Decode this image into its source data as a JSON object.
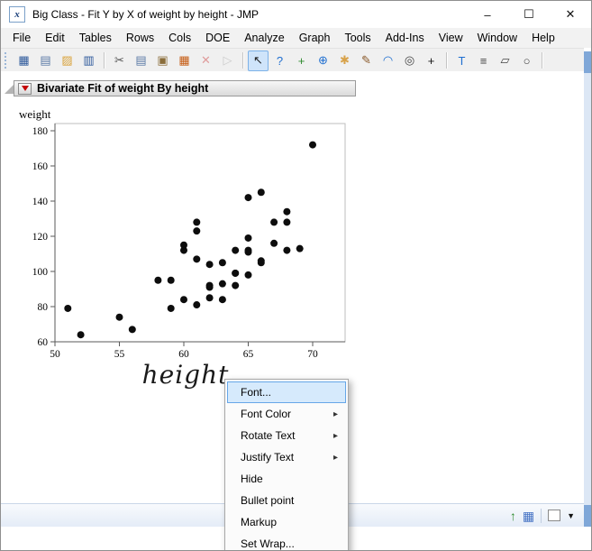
{
  "window": {
    "title": "Big Class - Fit Y by X of weight by height - JMP",
    "icon_glyph": "x",
    "controls": {
      "minimize": "–",
      "maximize": "☐",
      "close": "✕"
    }
  },
  "menu_bar": {
    "items": [
      "File",
      "Edit",
      "Tables",
      "Rows",
      "Cols",
      "DOE",
      "Analyze",
      "Graph",
      "Tools",
      "Add-Ins",
      "View",
      "Window",
      "Help"
    ]
  },
  "toolbar": {
    "buttons": [
      {
        "name": "new-data-table",
        "glyph": "▦",
        "color": "#2b579a"
      },
      {
        "name": "new-journal",
        "glyph": "▤",
        "color": "#5b7aa6"
      },
      {
        "name": "open",
        "glyph": "▨",
        "color": "#d9a33c"
      },
      {
        "name": "save",
        "glyph": "▥",
        "color": "#2b579a"
      },
      {
        "sep": true
      },
      {
        "name": "cut",
        "glyph": "✂",
        "color": "#555555"
      },
      {
        "name": "copy",
        "glyph": "▤",
        "color": "#5b7aa6"
      },
      {
        "name": "paste",
        "glyph": "▣",
        "color": "#8a6d3b"
      },
      {
        "name": "data-table",
        "glyph": "▦",
        "color": "#c55a11"
      },
      {
        "name": "delete",
        "glyph": "✕",
        "color": "#c00000",
        "disabled": true
      },
      {
        "name": "run-script",
        "glyph": "▷",
        "color": "#888888",
        "disabled": true
      },
      {
        "sep": true
      },
      {
        "name": "arrow-tool",
        "glyph": "↖",
        "color": "#222222",
        "selected": true
      },
      {
        "name": "help-tool",
        "glyph": "?",
        "color": "#1f6fd0"
      },
      {
        "name": "move-tool",
        "glyph": "+",
        "color": "#2e8b2e"
      },
      {
        "name": "globe-tool",
        "glyph": "⊕",
        "color": "#1f6fd0"
      },
      {
        "name": "hand-tool",
        "glyph": "✱",
        "color": "#d8a24a"
      },
      {
        "name": "brush-tool",
        "glyph": "✎",
        "color": "#8a5a2b"
      },
      {
        "name": "lasso-tool",
        "glyph": "◠",
        "color": "#1f6fd0"
      },
      {
        "name": "zoom-tool",
        "glyph": "◎",
        "color": "#444444"
      },
      {
        "name": "crosshair-tool",
        "glyph": "+",
        "color": "#111111"
      },
      {
        "sep": true
      },
      {
        "name": "annotate-tool",
        "glyph": "T",
        "color": "#1f6fd0"
      },
      {
        "name": "line-tool",
        "glyph": "≡",
        "color": "#444444"
      },
      {
        "name": "polygon-tool",
        "glyph": "▱",
        "color": "#444444"
      },
      {
        "name": "oval-tool",
        "glyph": "○",
        "color": "#444444"
      },
      {
        "sep": true
      }
    ]
  },
  "report": {
    "outline_title": "Bivariate Fit of weight By height"
  },
  "chart_data": {
    "type": "scatter",
    "title": "Bivariate Fit of weight By height",
    "xlabel": "height",
    "ylabel": "weight",
    "xlim": [
      50,
      70
    ],
    "ylim": [
      60,
      180
    ],
    "xticks": [
      50,
      55,
      60,
      65,
      70
    ],
    "yticks": [
      60,
      80,
      100,
      120,
      140,
      160,
      180
    ],
    "grid": false,
    "marker_color": "#0d0d0d",
    "points": [
      [
        59,
        95
      ],
      [
        61,
        123
      ],
      [
        55,
        74
      ],
      [
        66,
        145
      ],
      [
        52,
        64
      ],
      [
        60,
        84
      ],
      [
        61,
        128
      ],
      [
        51,
        79
      ],
      [
        60,
        112
      ],
      [
        61,
        107
      ],
      [
        56,
        67
      ],
      [
        65,
        98
      ],
      [
        63,
        105
      ],
      [
        58,
        95
      ],
      [
        59,
        79
      ],
      [
        61,
        81
      ],
      [
        62,
        91
      ],
      [
        65,
        142
      ],
      [
        63,
        84
      ],
      [
        62,
        85
      ],
      [
        63,
        93
      ],
      [
        64,
        99
      ],
      [
        65,
        119
      ],
      [
        64,
        92
      ],
      [
        68,
        112
      ],
      [
        64,
        99
      ],
      [
        69,
        113
      ],
      [
        62,
        92
      ],
      [
        64,
        112
      ],
      [
        67,
        128
      ],
      [
        65,
        111
      ],
      [
        66,
        105
      ],
      [
        62,
        104
      ],
      [
        66,
        106
      ],
      [
        65,
        112
      ],
      [
        60,
        115
      ],
      [
        68,
        128
      ],
      [
        67,
        116
      ],
      [
        68,
        134
      ],
      [
        70,
        172
      ]
    ]
  },
  "context_menu": {
    "submenu_arrow": "▸",
    "items": [
      {
        "label": "Font...",
        "highlighted": true,
        "submenu": false
      },
      {
        "label": "Font Color",
        "highlighted": false,
        "submenu": true
      },
      {
        "label": "Rotate Text",
        "highlighted": false,
        "submenu": true
      },
      {
        "label": "Justify Text",
        "highlighted": false,
        "submenu": true
      },
      {
        "label": "Hide",
        "highlighted": false,
        "submenu": false
      },
      {
        "label": "Bullet point",
        "highlighted": false,
        "submenu": false
      },
      {
        "label": "Markup",
        "highlighted": false,
        "submenu": false
      },
      {
        "label": "Set Wrap...",
        "highlighted": false,
        "submenu": false
      }
    ]
  },
  "status_bar": {
    "icons": [
      {
        "name": "status-window-up",
        "glyph": "↑",
        "color": "#2e8b2e"
      },
      {
        "name": "status-data-table",
        "glyph": "▦",
        "color": "#4472c4"
      }
    ],
    "dropdown_glyph": "▼"
  },
  "colors": {
    "selection_highlight": "#cfe4fa",
    "menu_highlight": "#d6eafc",
    "red_triangle": "#c40000",
    "scrollbar_track": "#dce7f5",
    "scrollbar_thumb": "#7fa7d8"
  }
}
